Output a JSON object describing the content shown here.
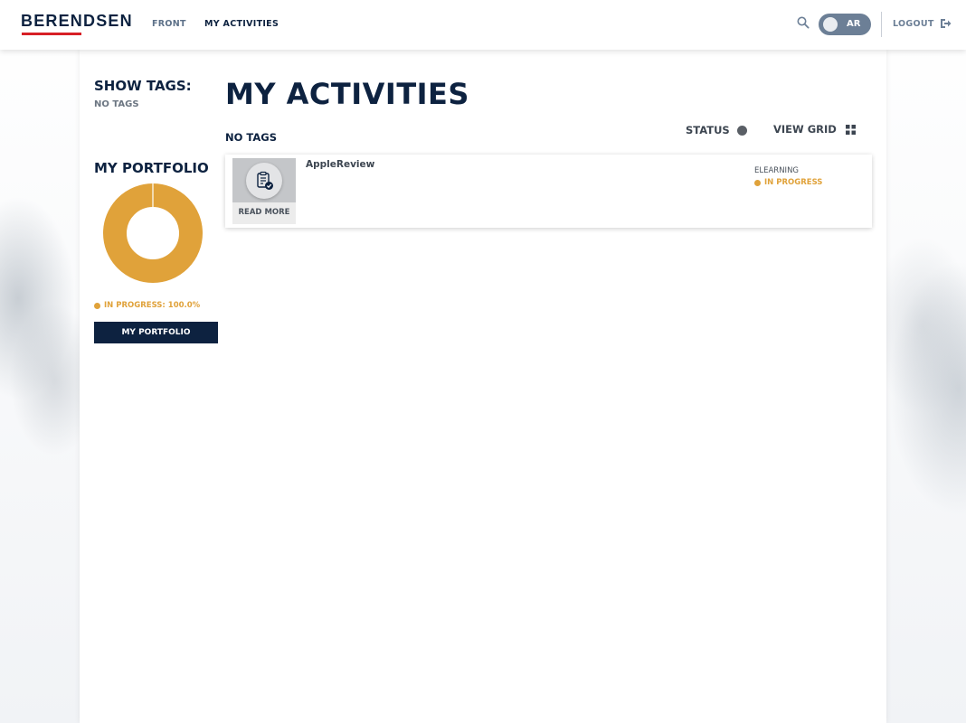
{
  "header": {
    "logo": "BERENDSEN",
    "nav": [
      {
        "label": "FRONT"
      },
      {
        "label": "MY ACTIVITIES"
      }
    ],
    "user_initials": "AR",
    "logout_label": "LOGOUT"
  },
  "sidebar": {
    "show_tags_label": "SHOW TAGS:",
    "no_tags_label": "NO TAGS",
    "portfolio_title": "MY PORTFOLIO",
    "portfolio_legend": "IN PROGRESS: 100.0%",
    "portfolio_button": "MY PORTFOLIO"
  },
  "chart_data": {
    "type": "pie",
    "categories": [
      "IN PROGRESS"
    ],
    "values": [
      100.0
    ]
  },
  "main": {
    "title": "MY ACTIVITIES",
    "no_tags_label": "NO TAGS",
    "status_label": "STATUS",
    "view_grid_label": "VIEW GRID",
    "activities": [
      {
        "title": "AppleReview",
        "type": "ELEARNING",
        "status": "IN PROGRESS",
        "read_more": "READ MORE"
      }
    ]
  },
  "colors": {
    "navy": "#0d2240",
    "accent_red": "#d71f26",
    "in_progress": "#e0a23a"
  },
  "icons": [
    "search-icon",
    "avatar",
    "logout-icon",
    "grid-icon",
    "checklist-icon"
  ]
}
